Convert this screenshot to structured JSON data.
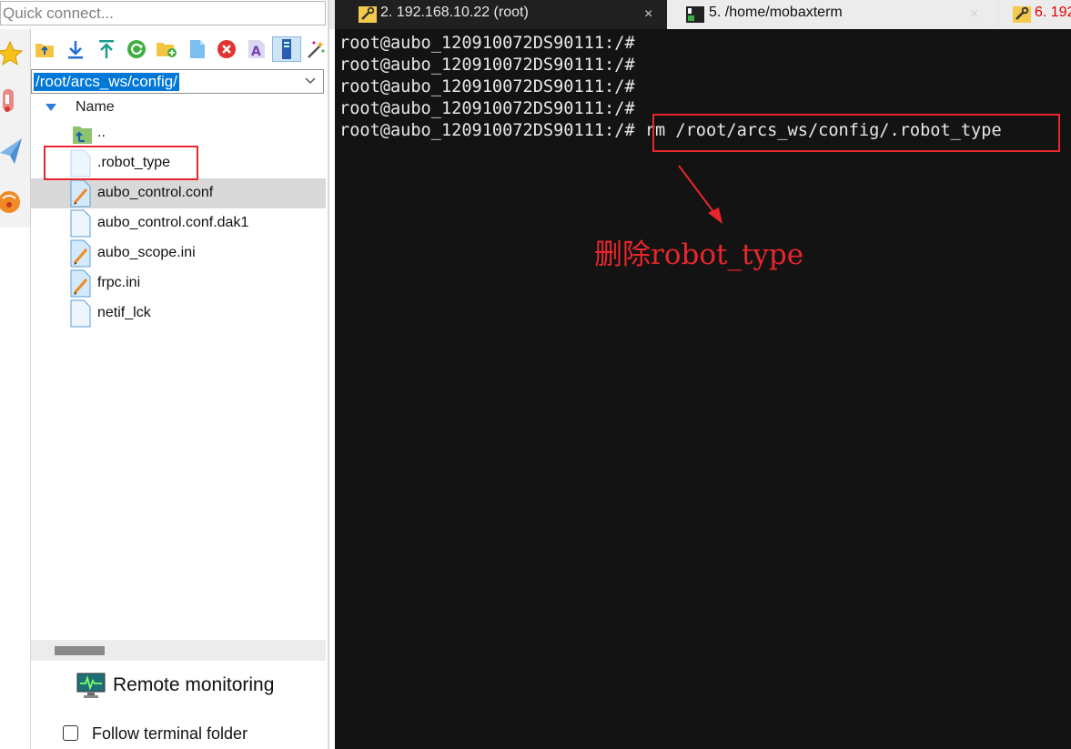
{
  "quick_connect": {
    "placeholder": "Quick connect..."
  },
  "browser": {
    "path": "/root/arcs_ws/config/",
    "column_header": "Name",
    "files": [
      {
        "name": "..",
        "icon": "parent-folder-icon",
        "selected": false
      },
      {
        "name": ".robot_type",
        "icon": "blank-file-icon",
        "selected": false
      },
      {
        "name": "aubo_control.conf",
        "icon": "config-file-icon",
        "selected": true
      },
      {
        "name": "aubo_control.conf.dak1",
        "icon": "blank-file-icon",
        "selected": false
      },
      {
        "name": "aubo_scope.ini",
        "icon": "config-file-icon",
        "selected": false
      },
      {
        "name": "frpc.ini",
        "icon": "config-file-icon",
        "selected": false
      },
      {
        "name": "netif_lck",
        "icon": "blank-file-icon",
        "selected": false
      }
    ],
    "toolbar_icons": [
      "upload-to-folder-icon",
      "download-icon",
      "upload-icon",
      "refresh-icon",
      "new-folder-icon",
      "new-file-icon",
      "delete-icon",
      "rename-icon",
      "ssh-browser-icon",
      "magic-wand-icon"
    ],
    "remote_monitoring_label": "Remote monitoring",
    "follow_terminal_label": "Follow terminal folder"
  },
  "sidebar_icons": [
    "sessions-star-icon",
    "tools-icon",
    "macros-icon",
    "games-icon"
  ],
  "tabs": [
    {
      "label": "2. 192.168.10.22 (root)",
      "icon": "ssh-key-icon",
      "active": true,
      "close": "×"
    },
    {
      "label": "5. /home/mobaxterm",
      "icon": "local-terminal-icon",
      "active": false,
      "close": "×"
    },
    {
      "label": "6. 192",
      "icon": "ssh-key-icon",
      "active": false
    }
  ],
  "terminal": {
    "lines": [
      "root@aubo_120910072DS90111:/#",
      "root@aubo_120910072DS90111:/#",
      "root@aubo_120910072DS90111:/#",
      "root@aubo_120910072DS90111:/#",
      "root@aubo_120910072DS90111:/# rm /root/arcs_ws/config/.robot_type"
    ]
  },
  "annotation": {
    "text": "删除robot_type",
    "color": "#e8262c"
  },
  "colors": {
    "terminal_bg": "#131313",
    "selection": "#0078d7",
    "annotation_red": "#e8262c"
  }
}
